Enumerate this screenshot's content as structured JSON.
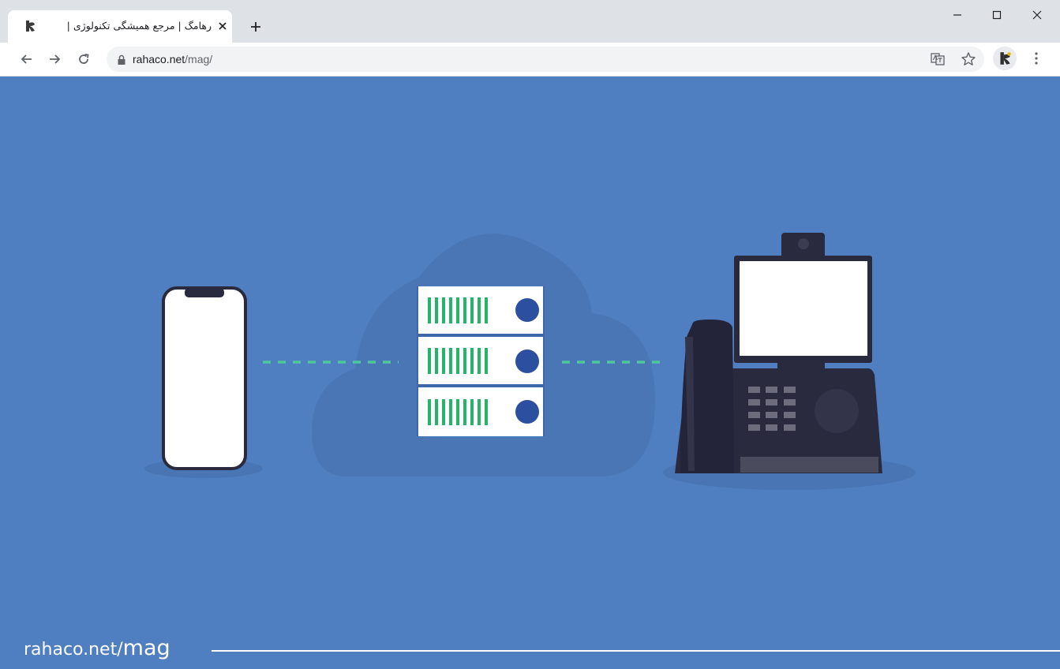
{
  "browser": {
    "tab": {
      "title": "رهامگ | مرجع همیشگی تکنولوژی |",
      "favicon": "rahaco-logo-icon"
    },
    "new_tab_icon": "plus-icon",
    "window_controls": [
      "minimize-icon",
      "maximize-icon",
      "close-icon"
    ],
    "toolbar": {
      "back_icon": "arrow-left-icon",
      "forward_icon": "arrow-right-icon",
      "reload_icon": "reload-icon",
      "url_host": "rahaco.net",
      "url_path": "/mag/",
      "translate_icon": "translate-icon",
      "bookmark_icon": "star-icon",
      "menu_icon": "kebab-menu-icon"
    }
  },
  "page": {
    "background_color": "#4f7fc1",
    "illustration": {
      "description_icons": [
        "smartphone-icon",
        "server-rack-icon",
        "cloud-shape",
        "desk-video-phone-icon"
      ],
      "accent_connector_color": "#4ec79a",
      "server_bar_color": "#27b36a",
      "server_dot_color": "#2c4fa0"
    },
    "watermark": {
      "host": "rahaco.net/",
      "path": "mag"
    }
  }
}
